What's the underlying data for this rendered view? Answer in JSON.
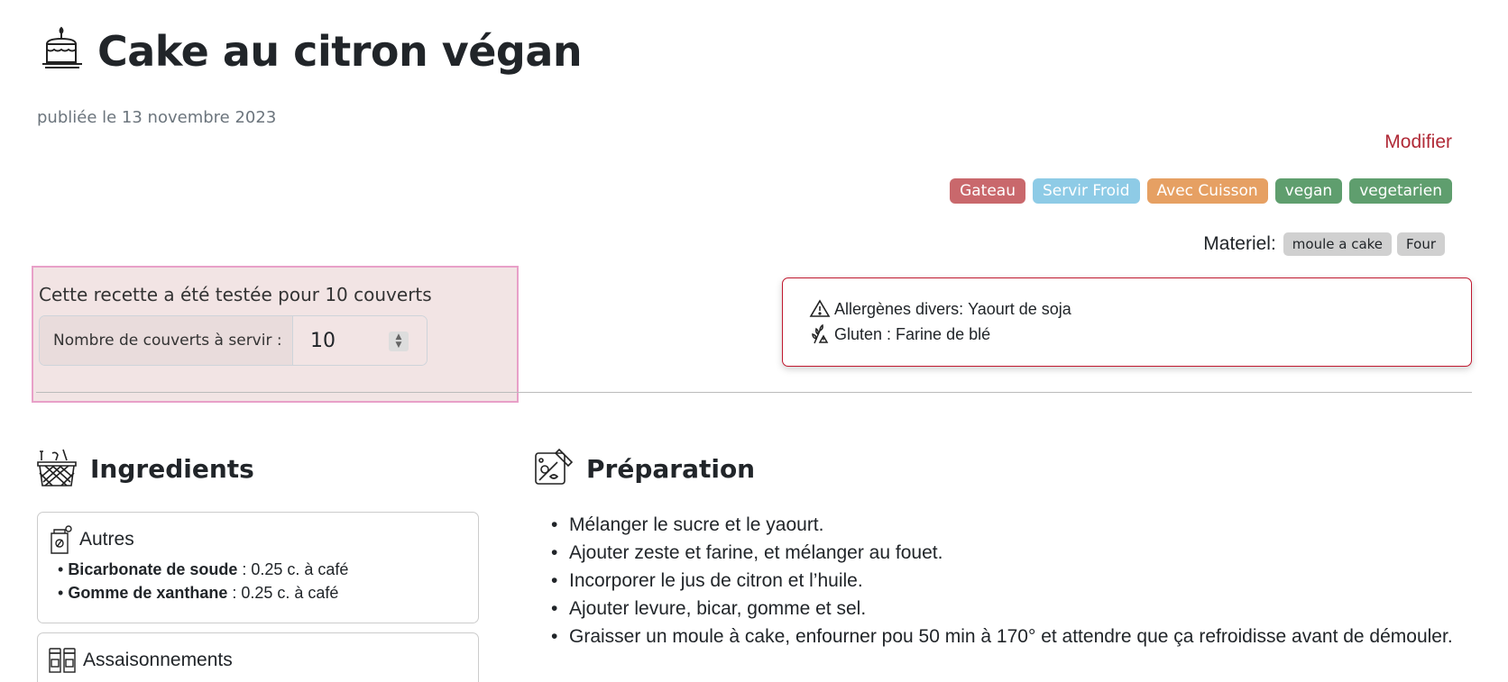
{
  "recipe": {
    "title": "Cake au citron végan",
    "published": "publiée le 13 novembre 2023",
    "modify_label": "Modifier"
  },
  "tags": [
    {
      "label": "Gateau",
      "color": "#c9686c"
    },
    {
      "label": "Servir Froid",
      "color": "#8ecbe6"
    },
    {
      "label": "Avec Cuisson",
      "color": "#e6a063"
    },
    {
      "label": "vegan",
      "color": "#5f9e6e"
    },
    {
      "label": "vegetarien",
      "color": "#5f9e6e"
    }
  ],
  "materiel": {
    "label": "Materiel:",
    "items": [
      "moule a cake",
      "Four"
    ]
  },
  "servings": {
    "tested_text": "Cette recette a été testée pour 10 couverts",
    "input_label": "Nombre de couverts à servir :",
    "value": "10"
  },
  "allergens": [
    {
      "icon": "warning-icon",
      "label": "Allergènes divers:",
      "value": "Yaourt de soja"
    },
    {
      "icon": "gluten-icon",
      "label": "Gluten :",
      "value": "Farine de blé"
    }
  ],
  "ingredients": {
    "heading": "Ingredients",
    "groups": [
      {
        "title": "Autres",
        "icon": "bag-icon",
        "items": [
          {
            "name": "Bicarbonate de soude",
            "qty": " : 0.25 c. à café"
          },
          {
            "name": "Gomme de xanthane",
            "qty": " : 0.25 c. à café"
          }
        ]
      },
      {
        "title": "Assaisonnements",
        "icon": "spice-jars-icon",
        "items": []
      }
    ]
  },
  "preparation": {
    "heading": "Préparation",
    "steps": [
      "Mélanger le sucre et le yaourt.",
      "Ajouter zeste et farine, et mélanger au fouet.",
      "Incorporer le jus de citron et l’huile.",
      "Ajouter levure, bicar, gomme et sel.",
      "Graisser un moule à cake, enfourner pou 50 min à 170° et attendre que ça refroidisse avant de démouler."
    ]
  }
}
